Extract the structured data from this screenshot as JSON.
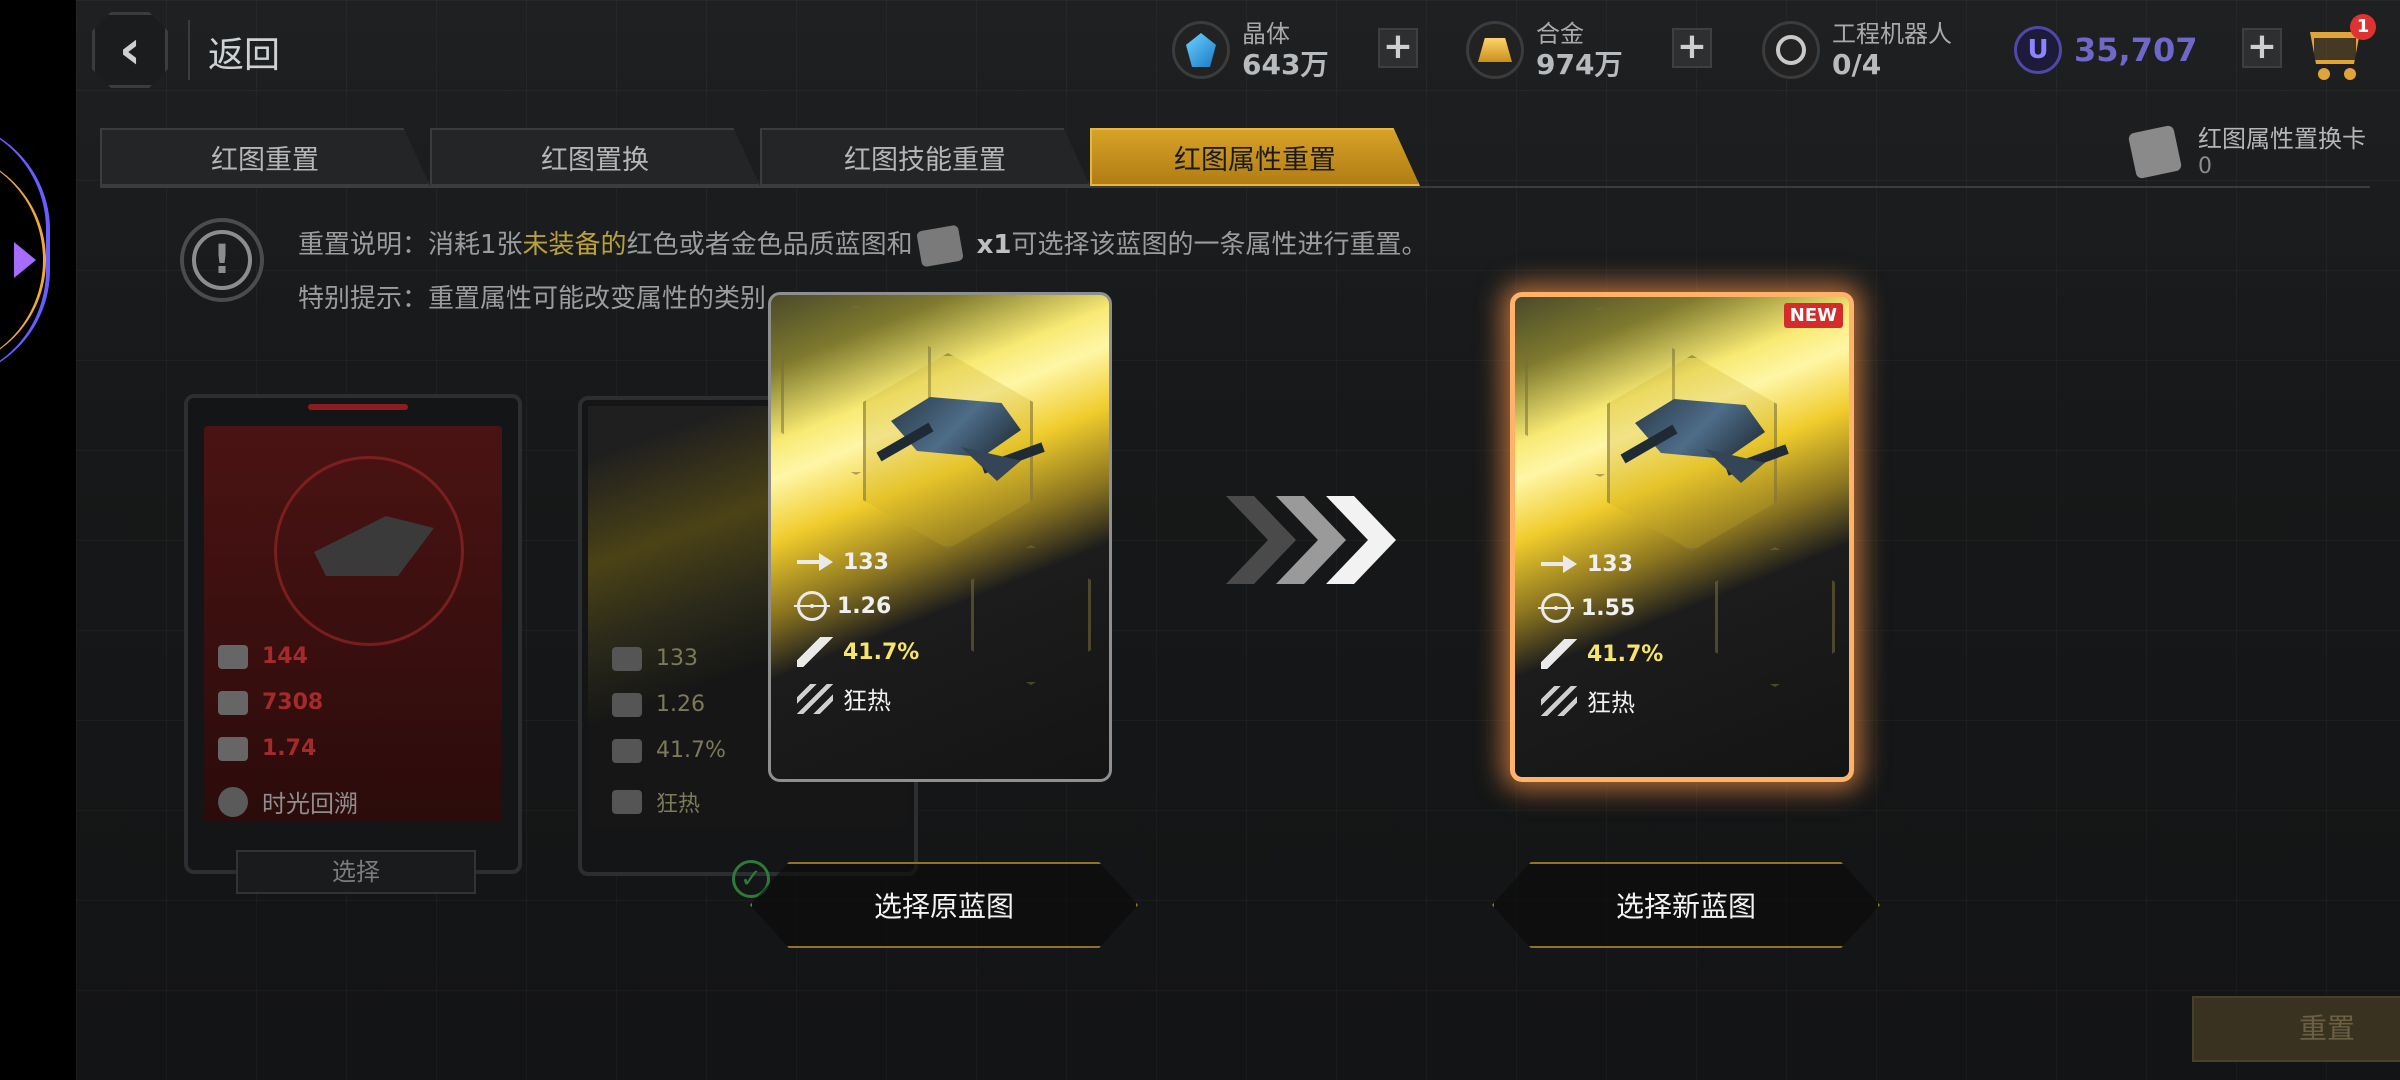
{
  "header": {
    "back_label": "返回",
    "resources": [
      {
        "name": "晶体",
        "value": "643万",
        "icon": "crystal-icon"
      },
      {
        "name": "合金",
        "value": "974万",
        "icon": "alloy-icon"
      },
      {
        "name": "工程机器人",
        "value": "0/4",
        "icon": "robot-icon"
      }
    ],
    "u_currency": {
      "icon_text": "U",
      "value": "35,707"
    },
    "plus_label": "+",
    "cart_badge": "1"
  },
  "tabs": [
    {
      "label": "红图重置",
      "active": false
    },
    {
      "label": "红图置换",
      "active": false
    },
    {
      "label": "红图技能重置",
      "active": false
    },
    {
      "label": "红图属性重置",
      "active": true
    }
  ],
  "swap_card": {
    "label": "红图属性置换卡",
    "count": "0"
  },
  "info": {
    "icon_text": "!",
    "line1_prefix": "重置说明：消耗1张",
    "line1_highlight": "未装备的",
    "line1_middle": "红色或者金色品质蓝图和",
    "line1_qty": "x1",
    "line1_suffix": "可选择该蓝图的一条属性进行重置。",
    "line2": "特别提示：重置属性可能改变属性的类别"
  },
  "bg_cards": {
    "red": {
      "stats": [
        "144",
        "7308",
        "1.74"
      ],
      "skill": "时光回溯",
      "select_label": "选择"
    },
    "dim": {
      "stats": [
        "133",
        "1.26",
        "41.7%"
      ],
      "skill": "狂热",
      "check": "✓"
    }
  },
  "original_card": {
    "speed": "133",
    "accuracy": "1.26",
    "rate": "41.7%",
    "skill": "狂热"
  },
  "new_card": {
    "badge": "NEW",
    "speed": "133",
    "accuracy": "1.55",
    "rate": "41.7%",
    "skill": "狂热"
  },
  "buttons": {
    "select_original": "选择原蓝图",
    "select_new": "选择新蓝图",
    "reset": "重置"
  },
  "colors": {
    "accent_gold": "#d7a227",
    "highlight": "#b9a03a",
    "new_glow": "#ffb26a",
    "u_purple": "#6f67c9"
  }
}
